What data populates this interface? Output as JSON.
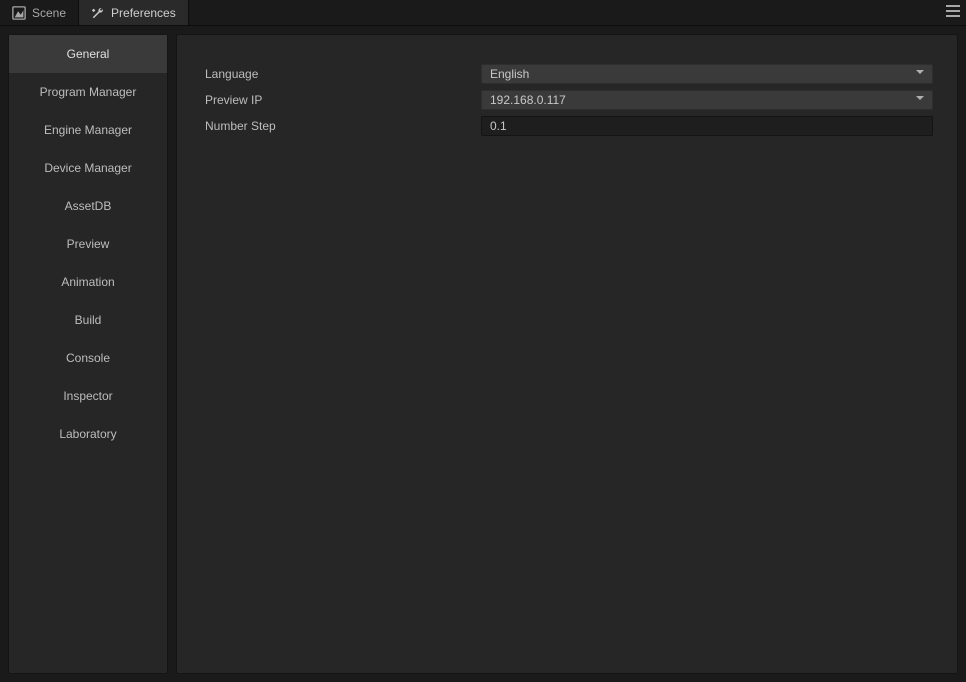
{
  "tabs": {
    "scene": "Scene",
    "preferences": "Preferences",
    "active": "preferences"
  },
  "sidebar": {
    "items": [
      {
        "id": "general",
        "label": "General",
        "active": true
      },
      {
        "id": "program-manager",
        "label": "Program Manager"
      },
      {
        "id": "engine-manager",
        "label": "Engine Manager"
      },
      {
        "id": "device-manager",
        "label": "Device Manager"
      },
      {
        "id": "assetdb",
        "label": "AssetDB"
      },
      {
        "id": "preview",
        "label": "Preview"
      },
      {
        "id": "animation",
        "label": "Animation"
      },
      {
        "id": "build",
        "label": "Build"
      },
      {
        "id": "console",
        "label": "Console"
      },
      {
        "id": "inspector",
        "label": "Inspector"
      },
      {
        "id": "laboratory",
        "label": "Laboratory"
      }
    ]
  },
  "form": {
    "language": {
      "label": "Language",
      "value": "English"
    },
    "preview_ip": {
      "label": "Preview IP",
      "value": "192.168.0.117"
    },
    "number_step": {
      "label": "Number Step",
      "value": "0.1"
    }
  }
}
